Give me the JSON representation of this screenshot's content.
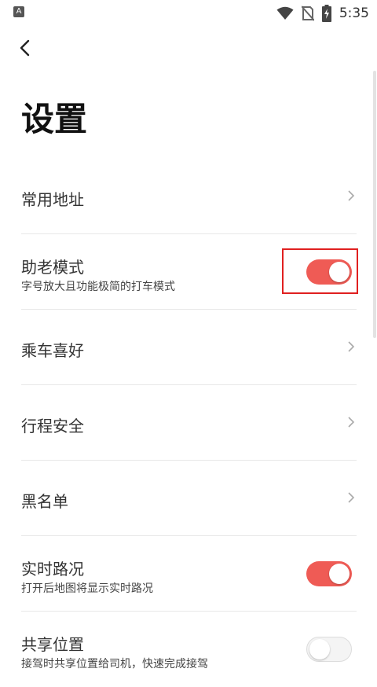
{
  "status_bar": {
    "app_icon": "A",
    "time": "5:35",
    "icons": [
      "wifi-icon",
      "no-sim-icon",
      "battery-charging-icon"
    ]
  },
  "header": {
    "back_icon": "chevron-left-icon",
    "title": "设置"
  },
  "settings": [
    {
      "label": "常用地址",
      "subtitle": "",
      "control": "chevron"
    },
    {
      "label": "助老模式",
      "subtitle": "字号放大且功能极简的打车模式",
      "control": "toggle",
      "on": true
    },
    {
      "label": "乘车喜好",
      "subtitle": "",
      "control": "chevron"
    },
    {
      "label": "行程安全",
      "subtitle": "",
      "control": "chevron"
    },
    {
      "label": "黑名单",
      "subtitle": "",
      "control": "chevron"
    },
    {
      "label": "实时路况",
      "subtitle": "打开后地图将显示实时路况",
      "control": "toggle",
      "on": true
    },
    {
      "label": "共享位置",
      "subtitle": "接驾时共享位置给司机，快速完成接驾",
      "control": "toggle",
      "on": false
    }
  ],
  "colors": {
    "accent": "#ef5b55",
    "highlight_box": "#e02020"
  }
}
